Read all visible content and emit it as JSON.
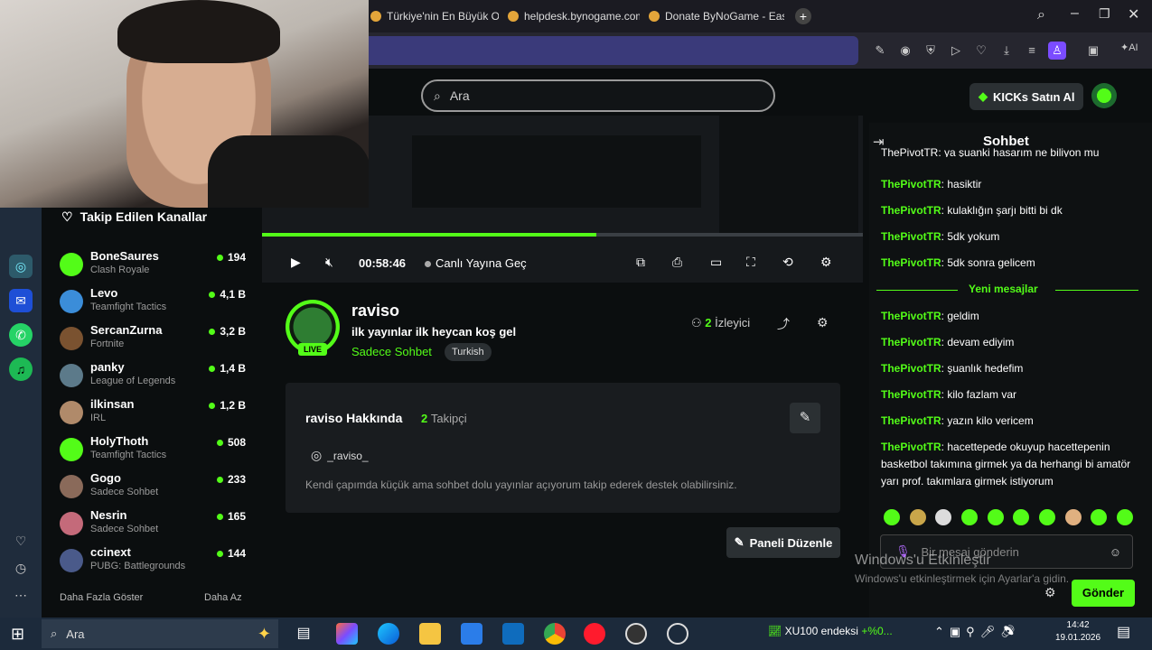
{
  "browser": {
    "tabs": [
      "Türkiye'nin En Büyük Oyu",
      "helpdesk.bynogame.com",
      "Donate ByNoGame - Eas"
    ],
    "ai_label": "AI"
  },
  "header": {
    "search_placeholder": "Ara",
    "kicks_label": "KICKs Satın Al"
  },
  "sidebar": {
    "title": "Takip Edilen Kanallar",
    "channels": [
      {
        "name": "BoneSaures",
        "game": "Clash Royale",
        "viewers": "194",
        "color": "#53fc18"
      },
      {
        "name": "Levo",
        "game": "Teamfight Tactics",
        "viewers": "4,1 B",
        "color": "#3b8dd9"
      },
      {
        "name": "SercanZurna",
        "game": "Fortnite",
        "viewers": "3,2 B",
        "color": "#7a5230"
      },
      {
        "name": "panky",
        "game": "League of Legends",
        "viewers": "1,4 B",
        "color": "#5c7a8a"
      },
      {
        "name": "ilkinsan",
        "game": "IRL",
        "viewers": "1,2 B",
        "color": "#b08a6a"
      },
      {
        "name": "HolyThoth",
        "game": "Teamfight Tactics",
        "viewers": "508",
        "color": "#53fc18"
      },
      {
        "name": "Gogo",
        "game": "Sadece Sohbet",
        "viewers": "233",
        "color": "#8a6a5a"
      },
      {
        "name": "Nesrin",
        "game": "Sadece Sohbet",
        "viewers": "165",
        "color": "#c46a7a"
      },
      {
        "name": "ccinext",
        "game": "PUBG: Battlegrounds",
        "viewers": "144",
        "color": "#4a5a8a"
      }
    ],
    "show_more": "Daha Fazla Göster",
    "show_less": "Daha Az"
  },
  "player": {
    "time": "00:58:46",
    "go_live": "Canlı Yayına Geç"
  },
  "channel": {
    "name": "raviso",
    "subtitle": "ilk yayınlar ilk heycan koş gel",
    "category": "Sadece Sohbet",
    "tag": "Turkish",
    "live_badge": "LIVE",
    "viewer_count": "2",
    "viewer_label": "İzleyici"
  },
  "about": {
    "title": "raviso Hakkında",
    "followers": "2",
    "followers_label": "Takipçi",
    "instagram": "_raviso_",
    "description": "Kendi çapımda küçük ama sohbet dolu yayınlar açıyorum takip ederek destek olabilirsiniz.",
    "panel_button": "Paneli Düzenle"
  },
  "chat": {
    "title": "Sohbet",
    "partial_top": "ThePivotTR: ya şuanki hasarım ne biliyon mu",
    "messages_before": [
      {
        "user": "ThePivotTR",
        "text": "hasiktir"
      },
      {
        "user": "ThePivotTR",
        "text": "kulaklığın şarjı bitti bi dk"
      },
      {
        "user": "ThePivotTR",
        "text": "5dk yokum"
      },
      {
        "user": "ThePivotTR",
        "text": "5dk sonra gelicem"
      }
    ],
    "new_messages": "Yeni mesajlar",
    "messages_after": [
      {
        "user": "ThePivotTR",
        "text": "geldim"
      },
      {
        "user": "ThePivotTR",
        "text": "devam ediyim"
      },
      {
        "user": "ThePivotTR",
        "text": "şuanlık hedefim"
      },
      {
        "user": "ThePivotTR",
        "text": "kilo fazlam var"
      },
      {
        "user": "ThePivotTR",
        "text": "yazın kilo vericem"
      },
      {
        "user": "ThePivotTR",
        "text": "hacettepede okuyup hacettepenin basketbol takımına girmek ya da herhangi bi amatör yarı prof. takımlara girmek istiyorum"
      }
    ],
    "input_placeholder": "Bir mesaj gönderin",
    "send": "Gönder"
  },
  "watermark": {
    "line1": "Windows'u Etkinleştir",
    "line2": "Windows'u etkinleştirmek için Ayarlar'a gidin."
  },
  "taskbar": {
    "search": "Ara",
    "stock": "XU100 endeksi",
    "stock_change": "+%0...",
    "time": "14:42",
    "date": "19.01.2026"
  },
  "colors": {
    "accent": "#53fc18",
    "bg": "#0b0e0f"
  }
}
